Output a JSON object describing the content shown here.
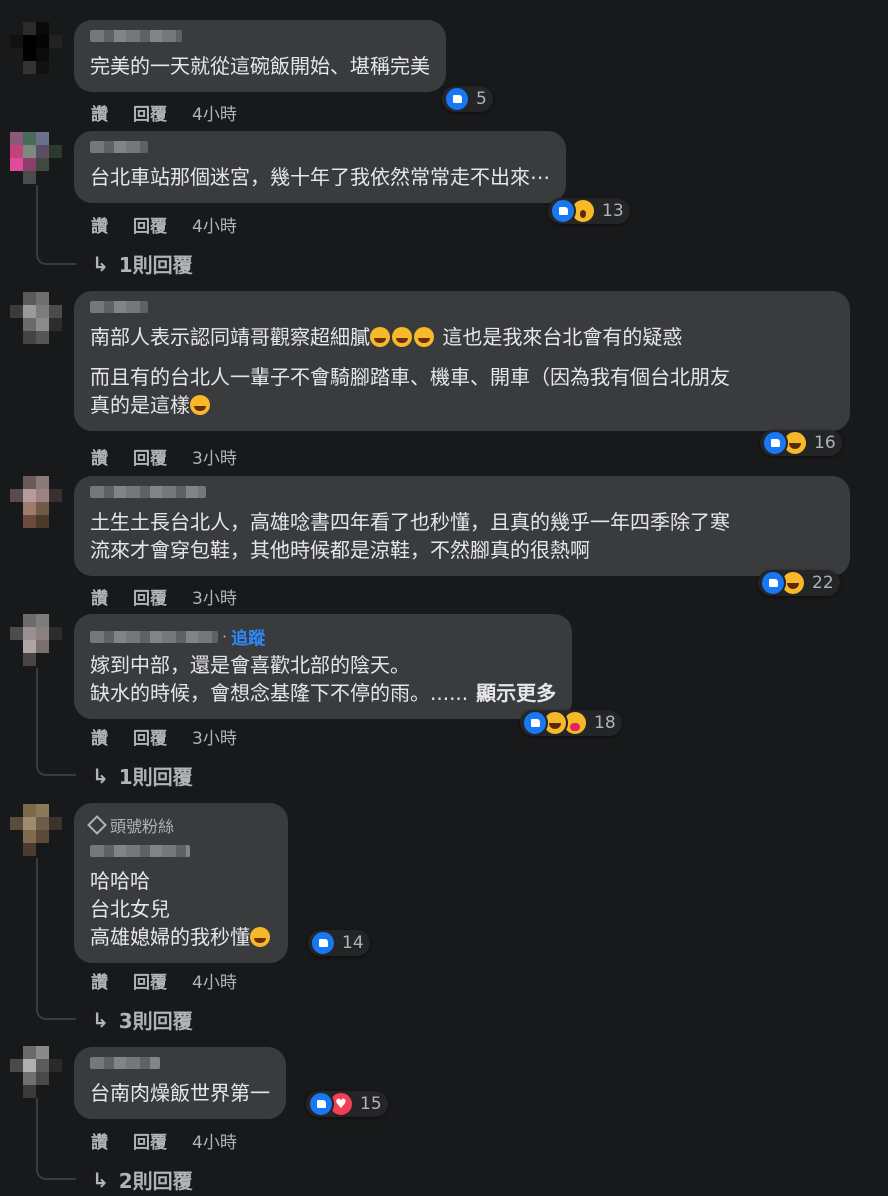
{
  "actions": {
    "like": "讚",
    "reply": "回覆"
  },
  "comments": [
    {
      "lines": [
        "完美的一天就從這碗飯開始、堪稱完美"
      ],
      "time": "4小時",
      "reactions_count": "5"
    },
    {
      "lines": [
        "台北車站那個迷宮，幾十年了我依然常常走不出來⋯"
      ],
      "time": "4小時",
      "reactions_count": "13",
      "replies": "1則回覆"
    },
    {
      "lines": [
        "南部人表示認同靖哥觀察超細膩",
        "這也是我來台北會有的疑惑",
        "而且有的台北人一輩子不會騎腳踏車、機車、開車（因為我有個台北朋友",
        "真的是這樣"
      ],
      "time": "3小時",
      "reactions_count": "16"
    },
    {
      "lines": [
        "土生土長台北人，高雄唸書四年看了也秒懂，且真的幾乎一年四季除了寒",
        "流來才會穿包鞋，其他時候都是涼鞋，不然腳真的很熱啊"
      ],
      "time": "3小時",
      "reactions_count": "22"
    },
    {
      "follow": "追蹤",
      "lines": [
        "嫁到中部，還是會喜歡北部的陰天。",
        "缺水的時候，會想念基隆下不停的雨。......"
      ],
      "see_more": "顯示更多",
      "time": "3小時",
      "reactions_count": "18",
      "replies": "1則回覆"
    },
    {
      "badge": "頭號粉絲",
      "lines": [
        "哈哈哈",
        "台北女兒",
        "高雄媳婦的我秒懂"
      ],
      "time": "4小時",
      "reactions_count": "14",
      "replies": "3則回覆"
    },
    {
      "lines": [
        "台南肉燥飯世界第一"
      ],
      "time": "4小時",
      "reactions_count": "15",
      "replies": "2則回覆"
    }
  ],
  "reply_arrow": "↳"
}
